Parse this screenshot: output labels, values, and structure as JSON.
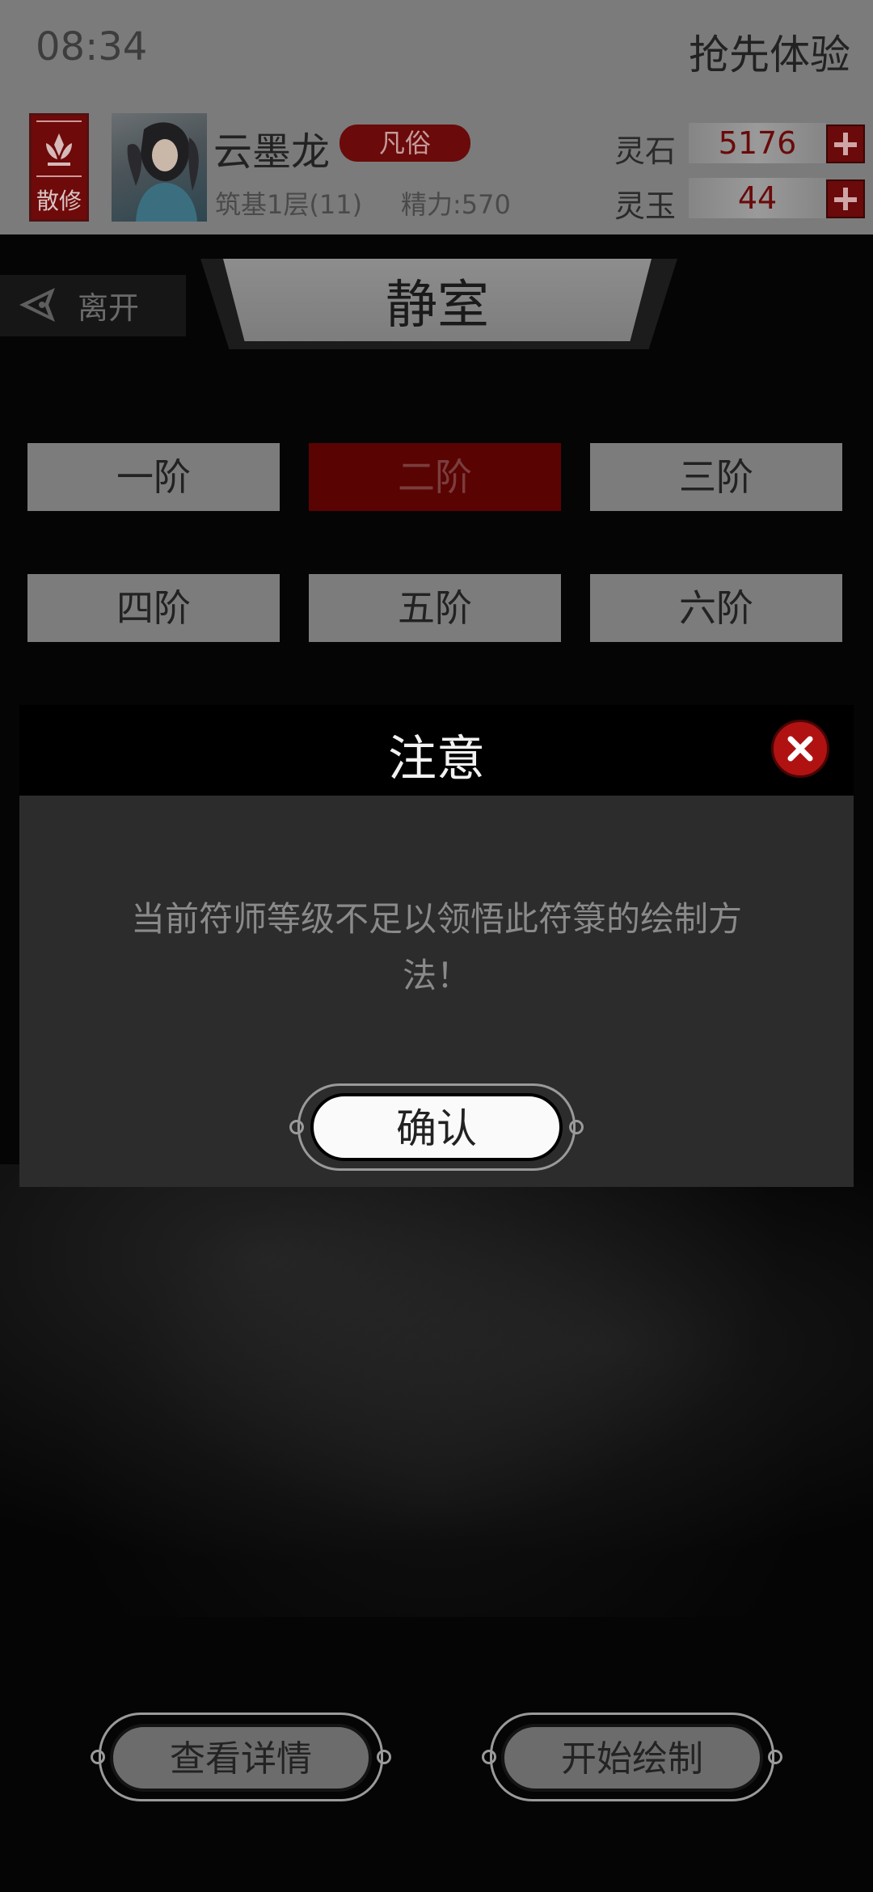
{
  "status_bar": {
    "time": "08:34",
    "early_access": "抢先体验"
  },
  "player": {
    "sect": "散修",
    "name": "云墨龙",
    "rank": "凡俗",
    "cultivation": "筑基1层(11)",
    "energy": "精力:570"
  },
  "resources": [
    {
      "label": "灵石",
      "value": "5176"
    },
    {
      "label": "灵玉",
      "value": "44"
    }
  ],
  "nav": {
    "leave_label": "离开",
    "page_title": "静室"
  },
  "tiers": [
    {
      "label": "一阶",
      "active": false
    },
    {
      "label": "二阶",
      "active": true
    },
    {
      "label": "三阶",
      "active": false
    },
    {
      "label": "四阶",
      "active": false
    },
    {
      "label": "五阶",
      "active": false
    },
    {
      "label": "六阶",
      "active": false
    }
  ],
  "modal": {
    "title": "注意",
    "message": "当前符师等级不足以领悟此符箓的绘制方法！",
    "confirm_label": "确认",
    "close_icon": "close-icon"
  },
  "bottom_buttons": {
    "details_label": "查看详情",
    "start_label": "开始绘制"
  },
  "colors": {
    "accent_red": "#6a0a0a",
    "active_tier": "#5a0303",
    "close_red": "#b01212"
  }
}
